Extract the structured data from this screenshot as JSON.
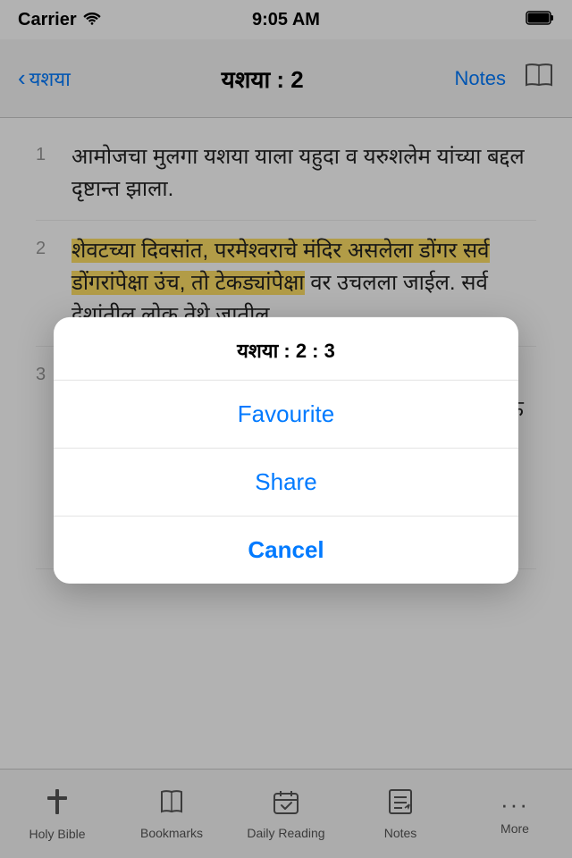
{
  "statusBar": {
    "carrier": "Carrier",
    "time": "9:05 AM",
    "battery": "🔋"
  },
  "navBar": {
    "backLabel": "यशया",
    "title": "यशया : 2",
    "notesLabel": "Notes"
  },
  "verses": [
    {
      "num": "1",
      "text": "आमोजचा मुलगा यशया याला यहुदा व यरुशलेम यांच्या बद्दल दृष्टान्त झाला.",
      "highlight": false
    },
    {
      "num": "2",
      "text": "शेवटच्या दिवसांत, परमेश्वराचे मंदिर असलेला डोंगर सर्व डोंगरांपेक्षा उंच, तो टेकड्यांपेक्षा वर उचलला जाईल. सर्व देशांतील लोक तेथे जातील.",
      "highlight": true
    },
    {
      "num": "3",
      "text": "पुष्कळ लोक तेथे जातील म्हणतील, \"आपण परमेश्वराच्या डोंगरावर जाऊ या. आपण याकोबाच्या देवाच्या मंदिरात जाऊ या. मग देव, त्याच्या जगण्याचा मार्ग आपल्याला दाखवील. आणि आपण त्या मार्गाने जाऊ.\" देवाच्या शिकवणुकीची सुरूवात, परमेश्वराच्या संदेशाचा आरंभ यरुशलेममधील सीयोनच्या डोंगरावरून होईल.",
      "highlight": false
    }
  ],
  "actionSheet": {
    "title": "यशया : 2 : 3",
    "buttons": [
      {
        "label": "Favourite",
        "type": "default"
      },
      {
        "label": "Share",
        "type": "default"
      },
      {
        "label": "Cancel",
        "type": "cancel"
      }
    ]
  },
  "tabBar": {
    "items": [
      {
        "icon": "✝",
        "label": "Holy Bible",
        "active": false
      },
      {
        "icon": "📖",
        "label": "Bookmarks",
        "active": false
      },
      {
        "icon": "📅",
        "label": "Daily Reading",
        "active": false
      },
      {
        "icon": "📝",
        "label": "Notes",
        "active": false
      },
      {
        "icon": "•••",
        "label": "More",
        "active": false
      }
    ]
  }
}
